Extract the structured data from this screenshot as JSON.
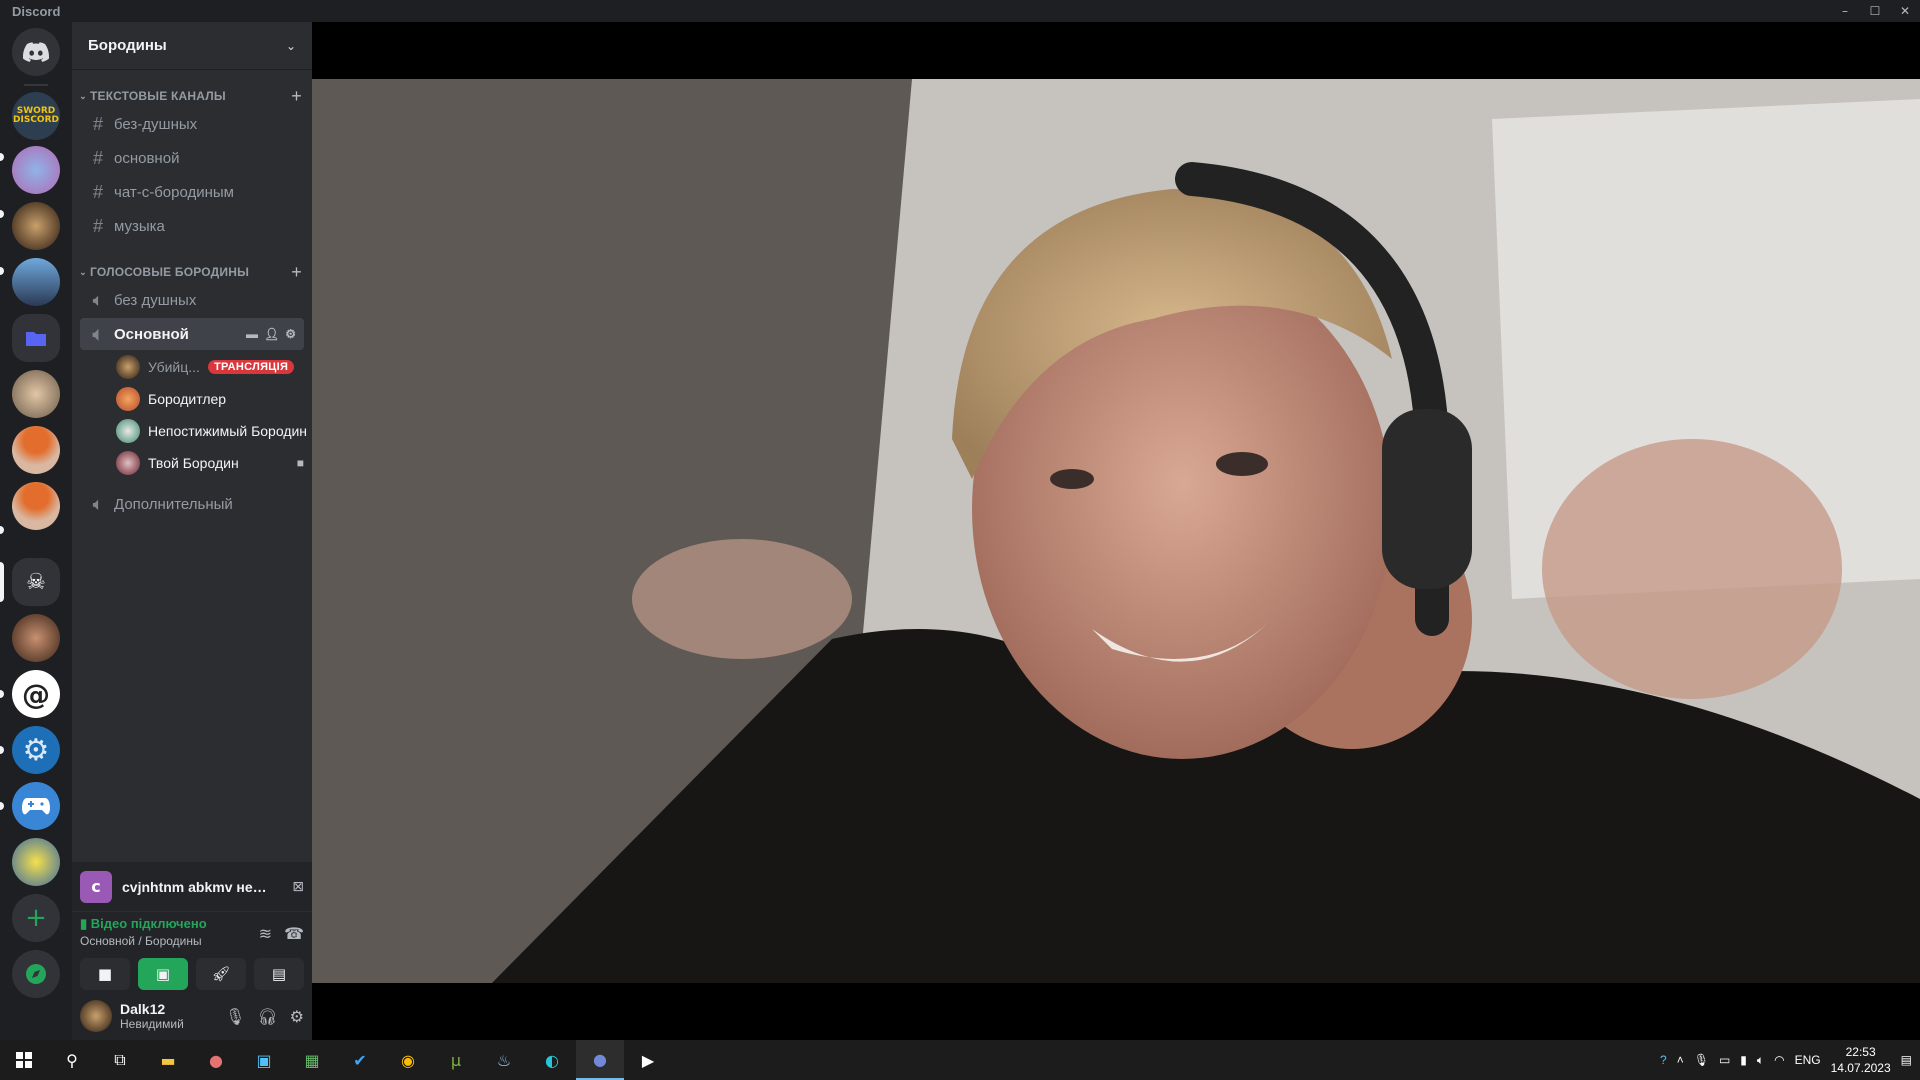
{
  "window": {
    "title": "Discord"
  },
  "server": {
    "name": "Бородины"
  },
  "text_category": {
    "label": "ТЕКСТОВЫЕ КАНАЛЫ"
  },
  "text_channels": [
    {
      "label": "без-душных"
    },
    {
      "label": "основной"
    },
    {
      "label": "чат-с-бородиным"
    },
    {
      "label": "музыка"
    }
  ],
  "voice_category": {
    "label": "ГОЛОСОВЫЕ БОРОДИНЫ"
  },
  "voice_channels": [
    {
      "label": "без душных"
    },
    {
      "label": "Основной"
    },
    {
      "label": "Дополнительный"
    }
  ],
  "voice_users": [
    {
      "name": "Убийц...",
      "badge": "ТРАНСЛЯЦІЯ"
    },
    {
      "name": "Бородитлер"
    },
    {
      "name": "Непостижимый Бородин"
    },
    {
      "name": "Твой Бородин"
    }
  ],
  "stream": {
    "icon_letter": "c",
    "title": "cvjnhtnm abkmv нелю..."
  },
  "connection": {
    "status": "Відео підключено",
    "location": "Основной / Бородины"
  },
  "user": {
    "name": "Dalk12",
    "status": "Невидимий"
  },
  "taskbar": {
    "lang": "ENG",
    "time": "22:53",
    "date": "14.07.2023"
  },
  "colors": {
    "accent": "#23a55a",
    "live": "#da373c",
    "sidebar": "#2b2d31",
    "guilds": "#1e1f22"
  }
}
